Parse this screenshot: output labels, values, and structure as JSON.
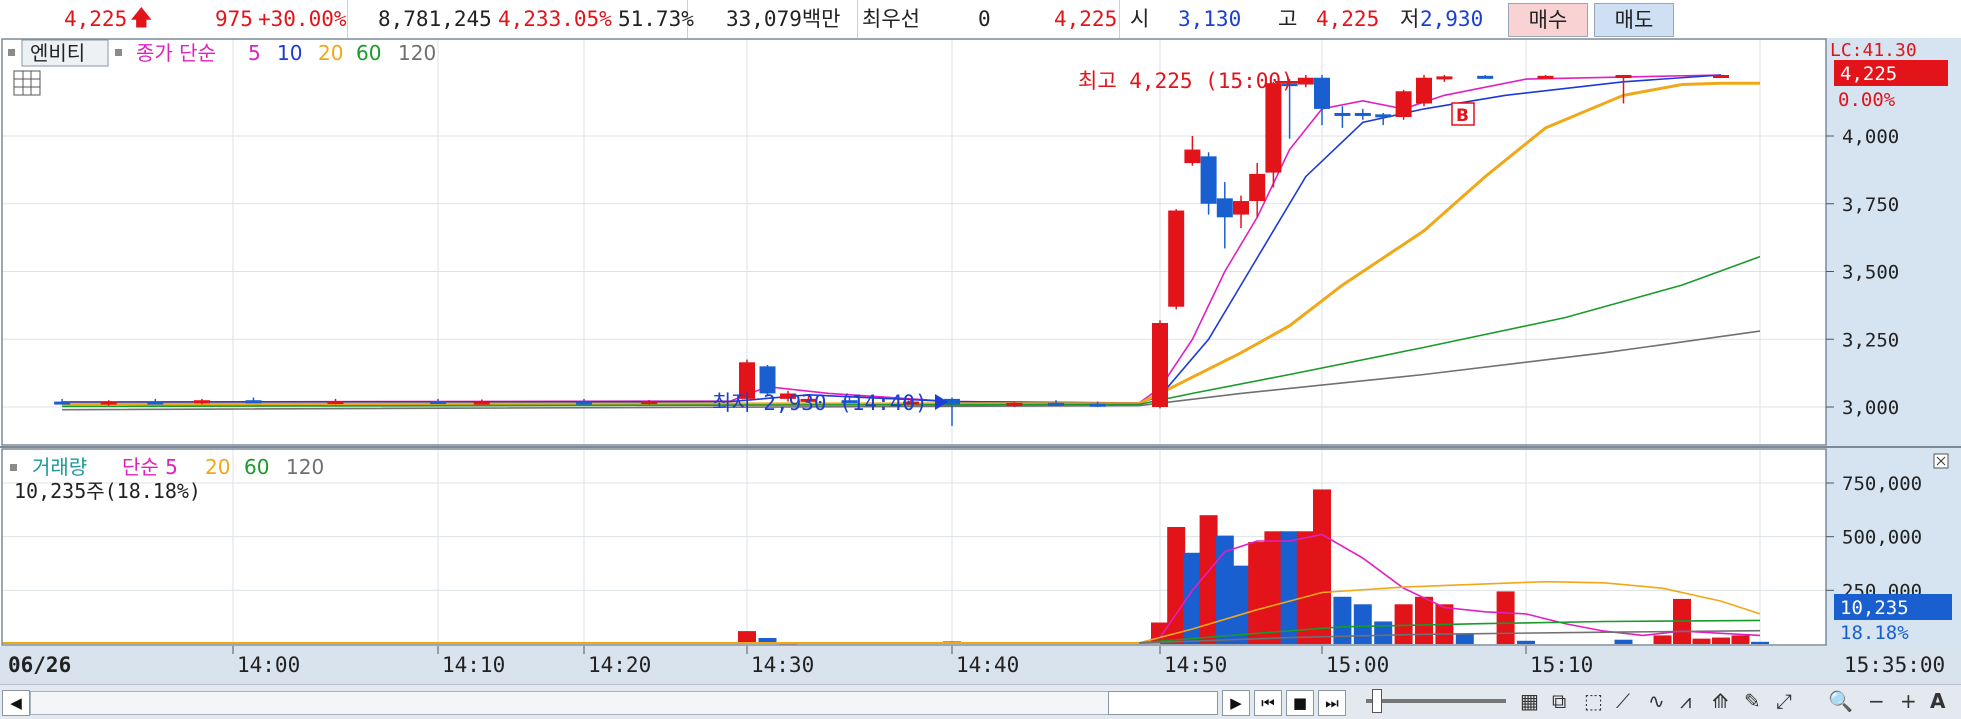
{
  "header": {
    "price": "4,225",
    "change": "975",
    "change_pct": "+30.00%",
    "volume": "8,781,245",
    "vol_ratio": "4,233.05%",
    "turnover": "51.73%",
    "amount": "33,079백만",
    "best_label": "최우선",
    "best_value": "0",
    "best_price": "4,225",
    "open_label": "시",
    "open_value": "3,130",
    "high_label": "고",
    "high_value": "4,225",
    "low_label": "저",
    "low_value": "2,930",
    "buy_label": "매수",
    "sell_label": "매도"
  },
  "colors": {
    "up": "#e3131a",
    "down": "#1a5fd0",
    "ma5": "#e020c0",
    "ma10": "#1c3ad6",
    "ma20": "#f0a818",
    "ma60": "#1a9a2a",
    "ma120": "#707070",
    "axis_bg": "#d6e4f2",
    "cursor_box": "#e3131a"
  },
  "price_panel": {
    "entity_label": "엔비티",
    "ma_title": "종가 단순",
    "ma_periods": [
      "5",
      "10",
      "20",
      "60",
      "120"
    ],
    "y_ticks": [
      "4,000",
      "3,750",
      "3,500",
      "3,250",
      "3,000"
    ],
    "y_top_label": "LC:41.30",
    "cursor_value": "4,225",
    "cursor_pct": "0.00%",
    "high_annotation": "최고 4,225 (15:00)",
    "low_annotation": "최저 2,930 (14:40)",
    "b_marker": "B"
  },
  "volume_panel": {
    "title": "거래량",
    "ma_title": "단순 5",
    "ma_periods": [
      "20",
      "60",
      "120"
    ],
    "current": "10,235주(18.18%)",
    "y_ticks": [
      "750,000",
      "500,000",
      "250,000"
    ],
    "cursor_value": "10,235",
    "cursor_pct": "18.18%"
  },
  "x_axis": {
    "date_label": "06/26",
    "ticks": [
      "14:00",
      "14:10",
      "14:20",
      "14:30",
      "14:40",
      "14:50",
      "15:00",
      "15:10"
    ],
    "cursor_time": "15:35:00"
  },
  "chart_data": {
    "type": "candlestick",
    "ylim": [
      2900,
      4300
    ],
    "volume_ylim": [
      0,
      860000
    ],
    "candles": [
      {
        "x": "13:49",
        "o": 3020,
        "h": 3030,
        "l": 3010,
        "c": 3015,
        "dir": "down"
      },
      {
        "x": "13:52",
        "o": 3010,
        "h": 3025,
        "l": 3005,
        "c": 3020,
        "dir": "up"
      },
      {
        "x": "13:55",
        "o": 3020,
        "h": 3030,
        "l": 3010,
        "c": 3015,
        "dir": "down"
      },
      {
        "x": "13:58",
        "o": 3015,
        "h": 3030,
        "l": 3010,
        "c": 3025,
        "dir": "up"
      },
      {
        "x": "14:01",
        "o": 3025,
        "h": 3035,
        "l": 3015,
        "c": 3020,
        "dir": "down"
      },
      {
        "x": "14:05",
        "o": 3020,
        "h": 3030,
        "l": 3010,
        "c": 3022,
        "dir": "up"
      },
      {
        "x": "14:10",
        "o": 3022,
        "h": 3030,
        "l": 3012,
        "c": 3018,
        "dir": "down"
      },
      {
        "x": "14:13",
        "o": 3018,
        "h": 3028,
        "l": 3010,
        "c": 3020,
        "dir": "up"
      },
      {
        "x": "14:20",
        "o": 3020,
        "h": 3030,
        "l": 3012,
        "c": 3016,
        "dir": "down"
      },
      {
        "x": "14:24",
        "o": 3016,
        "h": 3026,
        "l": 3010,
        "c": 3022,
        "dir": "up"
      },
      {
        "x": "14:30",
        "o": 3030,
        "h": 3175,
        "l": 3025,
        "c": 3165,
        "dir": "up"
      },
      {
        "x": "14:31",
        "o": 3150,
        "h": 3155,
        "l": 3040,
        "c": 3050,
        "dir": "down"
      },
      {
        "x": "14:32",
        "o": 3050,
        "h": 3060,
        "l": 3020,
        "c": 3030,
        "dir": "up"
      },
      {
        "x": "14:33",
        "o": 3030,
        "h": 3040,
        "l": 3020,
        "c": 3025,
        "dir": "up"
      },
      {
        "x": "14:35",
        "o": 3025,
        "h": 3035,
        "l": 3015,
        "c": 3020,
        "dir": "down"
      },
      {
        "x": "14:38",
        "o": 3020,
        "h": 3030,
        "l": 3010,
        "c": 3015,
        "dir": "up"
      },
      {
        "x": "14:40",
        "o": 3030,
        "h": 3035,
        "l": 2930,
        "c": 3010,
        "dir": "down"
      },
      {
        "x": "14:43",
        "o": 3010,
        "h": 3020,
        "l": 3000,
        "c": 3015,
        "dir": "up"
      },
      {
        "x": "14:45",
        "o": 3015,
        "h": 3025,
        "l": 3005,
        "c": 3010,
        "dir": "down"
      },
      {
        "x": "14:47",
        "o": 3010,
        "h": 3020,
        "l": 3000,
        "c": 3012,
        "dir": "down"
      },
      {
        "x": "14:50",
        "o": 3000,
        "h": 3320,
        "l": 2995,
        "c": 3310,
        "dir": "up"
      },
      {
        "x": "14:51",
        "o": 3370,
        "h": 3730,
        "l": 3360,
        "c": 3725,
        "dir": "up"
      },
      {
        "x": "14:52",
        "o": 3900,
        "h": 4000,
        "l": 3890,
        "c": 3950,
        "dir": "up"
      },
      {
        "x": "14:53",
        "o": 3925,
        "h": 3940,
        "l": 3710,
        "c": 3750,
        "dir": "down"
      },
      {
        "x": "14:54",
        "o": 3770,
        "h": 3830,
        "l": 3585,
        "c": 3700,
        "dir": "down"
      },
      {
        "x": "14:55",
        "o": 3710,
        "h": 3780,
        "l": 3660,
        "c": 3760,
        "dir": "up"
      },
      {
        "x": "14:56",
        "o": 3760,
        "h": 3900,
        "l": 3700,
        "c": 3860,
        "dir": "up"
      },
      {
        "x": "14:57",
        "o": 3865,
        "h": 4200,
        "l": 3810,
        "c": 4195,
        "dir": "up"
      },
      {
        "x": "14:58",
        "o": 4190,
        "h": 4210,
        "l": 3990,
        "c": 4195,
        "dir": "down"
      },
      {
        "x": "14:59",
        "o": 4190,
        "h": 4225,
        "l": 4180,
        "c": 4215,
        "dir": "up"
      },
      {
        "x": "15:00",
        "o": 4215,
        "h": 4225,
        "l": 4040,
        "c": 4100,
        "dir": "down"
      },
      {
        "x": "15:01",
        "o": 4085,
        "h": 4110,
        "l": 4030,
        "c": 4080,
        "dir": "down"
      },
      {
        "x": "15:02",
        "o": 4085,
        "h": 4100,
        "l": 4060,
        "c": 4075,
        "dir": "down"
      },
      {
        "x": "15:03",
        "o": 4080,
        "h": 4085,
        "l": 4040,
        "c": 4070,
        "dir": "down"
      },
      {
        "x": "15:04",
        "o": 4070,
        "h": 4170,
        "l": 4060,
        "c": 4165,
        "dir": "up"
      },
      {
        "x": "15:05",
        "o": 4120,
        "h": 4225,
        "l": 4110,
        "c": 4215,
        "dir": "up"
      },
      {
        "x": "15:06",
        "o": 4210,
        "h": 4225,
        "l": 4200,
        "c": 4220,
        "dir": "up"
      },
      {
        "x": "15:08",
        "o": 4220,
        "h": 4225,
        "l": 4215,
        "c": 4222,
        "dir": "down"
      },
      {
        "x": "15:11",
        "o": 4222,
        "h": 4225,
        "l": 4215,
        "c": 4220,
        "dir": "up"
      },
      {
        "x": "15:15",
        "o": 4220,
        "h": 4225,
        "l": 4120,
        "c": 4225,
        "dir": "up"
      },
      {
        "x": "15:20",
        "o": 4225,
        "h": 4225,
        "l": 4220,
        "c": 4225,
        "dir": "up"
      }
    ],
    "ma_lines": [
      {
        "name": "5",
        "color": "ma5",
        "points": [
          [
            "13:49",
            3018
          ],
          [
            "14:29",
            3022
          ],
          [
            "14:31",
            3075
          ],
          [
            "14:34",
            3050
          ],
          [
            "14:40",
            3020
          ],
          [
            "14:49",
            3015
          ],
          [
            "14:50",
            3070
          ],
          [
            "14:52",
            3250
          ],
          [
            "14:54",
            3500
          ],
          [
            "14:56",
            3700
          ],
          [
            "14:58",
            3950
          ],
          [
            "15:00",
            4100
          ],
          [
            "15:02",
            4130
          ],
          [
            "15:04",
            4100
          ],
          [
            "15:06",
            4150
          ],
          [
            "15:10",
            4210
          ],
          [
            "15:20",
            4225
          ]
        ]
      },
      {
        "name": "10",
        "color": "ma10",
        "points": [
          [
            "13:49",
            3018
          ],
          [
            "14:29",
            3020
          ],
          [
            "14:33",
            3045
          ],
          [
            "14:40",
            3020
          ],
          [
            "14:49",
            3014
          ],
          [
            "14:50",
            3040
          ],
          [
            "14:53",
            3250
          ],
          [
            "14:56",
            3550
          ],
          [
            "14:59",
            3850
          ],
          [
            "15:02",
            4050
          ],
          [
            "15:05",
            4100
          ],
          [
            "15:09",
            4150
          ],
          [
            "15:15",
            4200
          ],
          [
            "15:20",
            4225
          ]
        ]
      },
      {
        "name": "20",
        "color": "ma20",
        "points": [
          [
            "13:49",
            3010
          ],
          [
            "14:49",
            3012
          ],
          [
            "14:51",
            3080
          ],
          [
            "14:55",
            3200
          ],
          [
            "14:58",
            3300
          ],
          [
            "15:01",
            3450
          ],
          [
            "15:05",
            3650
          ],
          [
            "15:08",
            3850
          ],
          [
            "15:11",
            4030
          ],
          [
            "15:15",
            4150
          ],
          [
            "15:18",
            4190
          ],
          [
            "15:20",
            4195
          ],
          [
            "15:22",
            4195
          ]
        ]
      },
      {
        "name": "60",
        "color": "ma60",
        "points": [
          [
            "13:49",
            3002
          ],
          [
            "14:49",
            3010
          ],
          [
            "14:52",
            3050
          ],
          [
            "14:58",
            3120
          ],
          [
            "15:05",
            3220
          ],
          [
            "15:12",
            3330
          ],
          [
            "15:18",
            3450
          ],
          [
            "15:22",
            3555
          ]
        ]
      },
      {
        "name": "120",
        "color": "ma120",
        "points": [
          [
            "13:49",
            2990
          ],
          [
            "14:49",
            3005
          ],
          [
            "14:55",
            3050
          ],
          [
            "15:05",
            3120
          ],
          [
            "15:14",
            3200
          ],
          [
            "15:22",
            3280
          ]
        ]
      }
    ],
    "volume": [
      {
        "x": "14:30",
        "v": 60000,
        "dir": "up"
      },
      {
        "x": "14:31",
        "v": 28000,
        "dir": "down"
      },
      {
        "x": "14:32",
        "v": 8000,
        "dir": "up"
      },
      {
        "x": "14:40",
        "v": 12000,
        "dir": "down"
      },
      {
        "x": "14:50",
        "v": 100000,
        "dir": "up"
      },
      {
        "x": "14:51",
        "v": 545000,
        "dir": "up"
      },
      {
        "x": "14:52",
        "v": 425000,
        "dir": "down"
      },
      {
        "x": "14:53",
        "v": 600000,
        "dir": "up"
      },
      {
        "x": "14:54",
        "v": 505000,
        "dir": "down"
      },
      {
        "x": "14:55",
        "v": 365000,
        "dir": "down"
      },
      {
        "x": "14:56",
        "v": 475000,
        "dir": "up"
      },
      {
        "x": "14:57",
        "v": 525000,
        "dir": "up"
      },
      {
        "x": "14:58",
        "v": 525000,
        "dir": "down"
      },
      {
        "x": "14:59",
        "v": 525000,
        "dir": "up"
      },
      {
        "x": "15:00",
        "v": 720000,
        "dir": "up"
      },
      {
        "x": "15:01",
        "v": 220000,
        "dir": "down"
      },
      {
        "x": "15:02",
        "v": 185000,
        "dir": "down"
      },
      {
        "x": "15:03",
        "v": 105000,
        "dir": "down"
      },
      {
        "x": "15:04",
        "v": 185000,
        "dir": "up"
      },
      {
        "x": "15:05",
        "v": 220000,
        "dir": "up"
      },
      {
        "x": "15:06",
        "v": 185000,
        "dir": "up"
      },
      {
        "x": "15:07",
        "v": 45000,
        "dir": "down"
      },
      {
        "x": "15:09",
        "v": 245000,
        "dir": "up"
      },
      {
        "x": "15:10",
        "v": 15000,
        "dir": "down"
      },
      {
        "x": "15:15",
        "v": 20000,
        "dir": "down"
      },
      {
        "x": "15:17",
        "v": 40000,
        "dir": "up"
      },
      {
        "x": "15:18",
        "v": 210000,
        "dir": "up"
      },
      {
        "x": "15:19",
        "v": 25000,
        "dir": "up"
      },
      {
        "x": "15:20",
        "v": 30000,
        "dir": "up"
      },
      {
        "x": "15:21",
        "v": 40000,
        "dir": "up"
      },
      {
        "x": "15:22",
        "v": 10235,
        "dir": "down"
      }
    ],
    "volume_ma": [
      {
        "name": "5",
        "color": "ma5",
        "points": [
          [
            "14:49",
            5000
          ],
          [
            "14:50",
            30000
          ],
          [
            "14:52",
            250000
          ],
          [
            "14:54",
            430000
          ],
          [
            "14:56",
            480000
          ],
          [
            "14:58",
            480000
          ],
          [
            "15:00",
            510000
          ],
          [
            "15:02",
            400000
          ],
          [
            "15:04",
            260000
          ],
          [
            "15:06",
            170000
          ],
          [
            "15:08",
            150000
          ],
          [
            "15:10",
            140000
          ],
          [
            "15:12",
            95000
          ],
          [
            "15:14",
            60000
          ],
          [
            "15:16",
            40000
          ],
          [
            "15:18",
            60000
          ],
          [
            "15:20",
            50000
          ],
          [
            "15:22",
            40000
          ]
        ]
      },
      {
        "name": "20",
        "color": "ma20",
        "points": [
          [
            "14:49",
            5000
          ],
          [
            "14:52",
            70000
          ],
          [
            "14:56",
            160000
          ],
          [
            "15:00",
            240000
          ],
          [
            "15:04",
            265000
          ],
          [
            "15:08",
            280000
          ],
          [
            "15:11",
            290000
          ],
          [
            "15:14",
            285000
          ],
          [
            "15:17",
            260000
          ],
          [
            "15:20",
            200000
          ],
          [
            "15:22",
            140000
          ]
        ]
      },
      {
        "name": "60",
        "color": "ma60",
        "points": [
          [
            "14:49",
            5000
          ],
          [
            "14:56",
            50000
          ],
          [
            "15:01",
            80000
          ],
          [
            "15:08",
            95000
          ],
          [
            "15:14",
            105000
          ],
          [
            "15:22",
            110000
          ]
        ]
      },
      {
        "name": "120",
        "color": "ma120",
        "points": [
          [
            "14:49",
            4000
          ],
          [
            "14:58",
            30000
          ],
          [
            "15:05",
            45000
          ],
          [
            "15:14",
            55000
          ],
          [
            "15:22",
            62000
          ]
        ]
      }
    ]
  }
}
